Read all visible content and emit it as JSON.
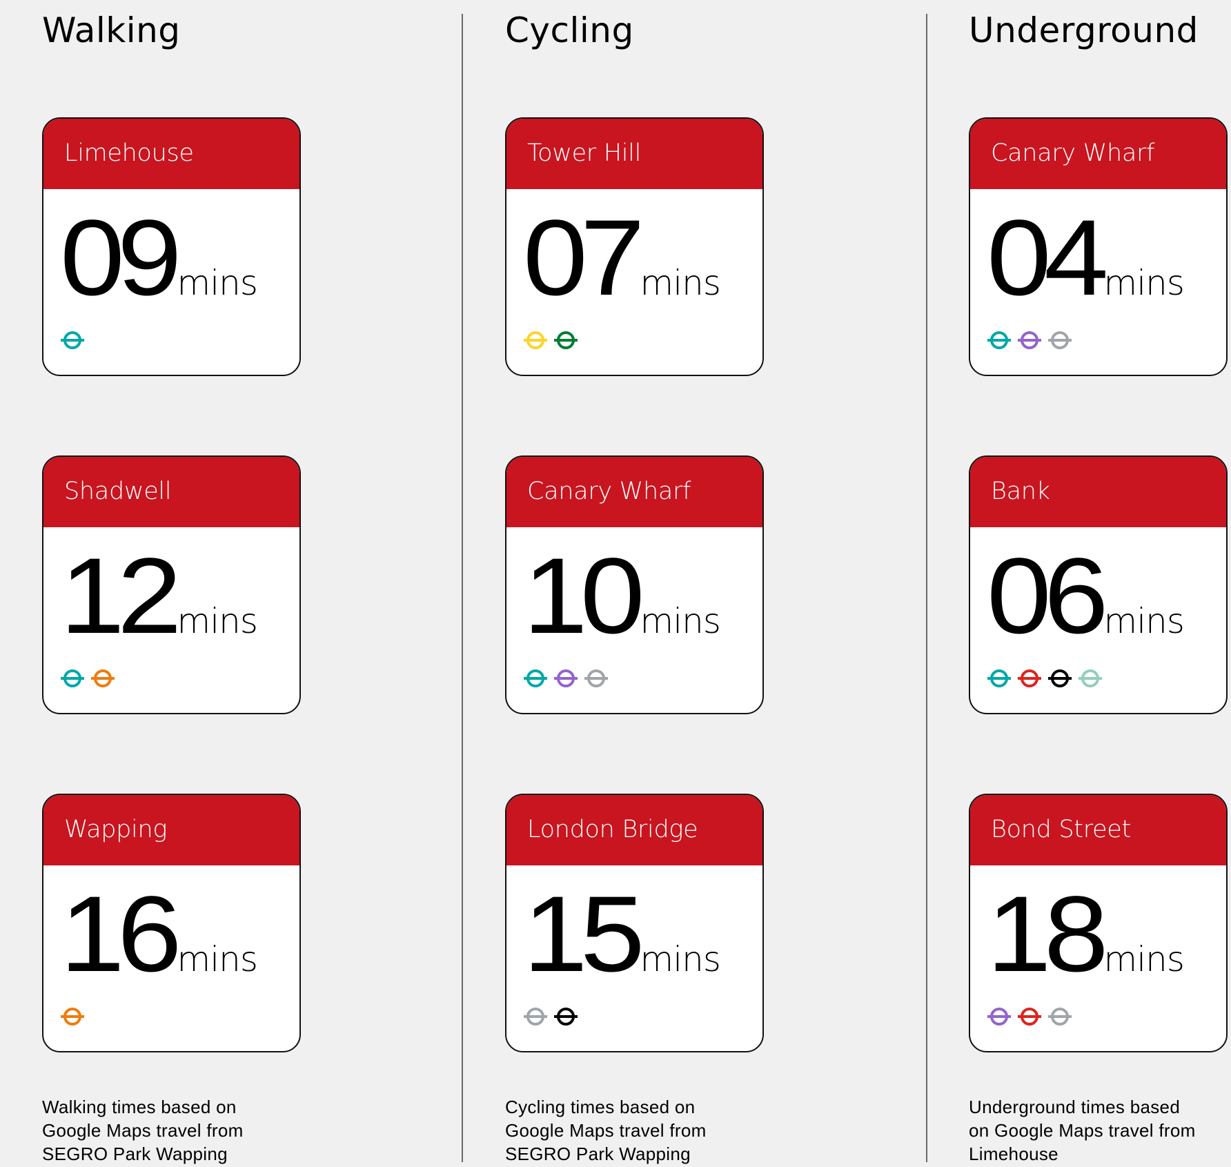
{
  "colors": {
    "background": "#f0f0f0",
    "header_red": "#c8151f",
    "divider": "#6a6a6a"
  },
  "columns": [
    {
      "title": "Walking",
      "cards": [
        {
          "station": "Limehouse",
          "minutes": "09",
          "unit": "mins",
          "lines": [
            "dlr"
          ]
        },
        {
          "station": "Shadwell",
          "minutes": "12",
          "unit": "mins",
          "lines": [
            "dlr",
            "overground"
          ]
        },
        {
          "station": "Wapping",
          "minutes": "16",
          "unit": "mins",
          "lines": [
            "overground"
          ]
        }
      ],
      "footnote": [
        "Walking times based on",
        "Google Maps travel from",
        "SEGRO Park Wapping"
      ]
    },
    {
      "title": "Cycling",
      "cards": [
        {
          "station": "Tower Hill",
          "minutes": "07",
          "unit": "mins",
          "lines": [
            "circle",
            "district"
          ]
        },
        {
          "station": "Canary Wharf",
          "minutes": "10",
          "unit": "mins",
          "lines": [
            "dlr",
            "elizabeth",
            "jubilee"
          ]
        },
        {
          "station": "London Bridge",
          "minutes": "15",
          "unit": "mins",
          "lines": [
            "jubilee",
            "northern"
          ]
        }
      ],
      "footnote": [
        "Cycling times based on",
        "Google Maps travel from",
        "SEGRO Park Wapping"
      ]
    },
    {
      "title": "Underground",
      "cards": [
        {
          "station": "Canary Wharf",
          "minutes": "04",
          "unit": "mins",
          "lines": [
            "dlr",
            "elizabeth",
            "jubilee"
          ]
        },
        {
          "station": "Bank",
          "minutes": "06",
          "unit": "mins",
          "lines": [
            "dlr",
            "central",
            "northern",
            "waterloo-city"
          ]
        },
        {
          "station": "Bond Street",
          "minutes": "18",
          "unit": "mins",
          "lines": [
            "elizabeth",
            "central",
            "jubilee"
          ]
        }
      ],
      "footnote": [
        "Underground times based",
        "on Google Maps travel from",
        "Limehouse"
      ]
    }
  ],
  "line_colors": {
    "dlr": "#00a8a8",
    "overground": "#ee7c0e",
    "circle": "#ffd329",
    "district": "#007d32",
    "elizabeth": "#9364cc",
    "jubilee": "#a0a5a9",
    "central": "#dc241f",
    "northern": "#000000",
    "waterloo-city": "#93ceba"
  }
}
